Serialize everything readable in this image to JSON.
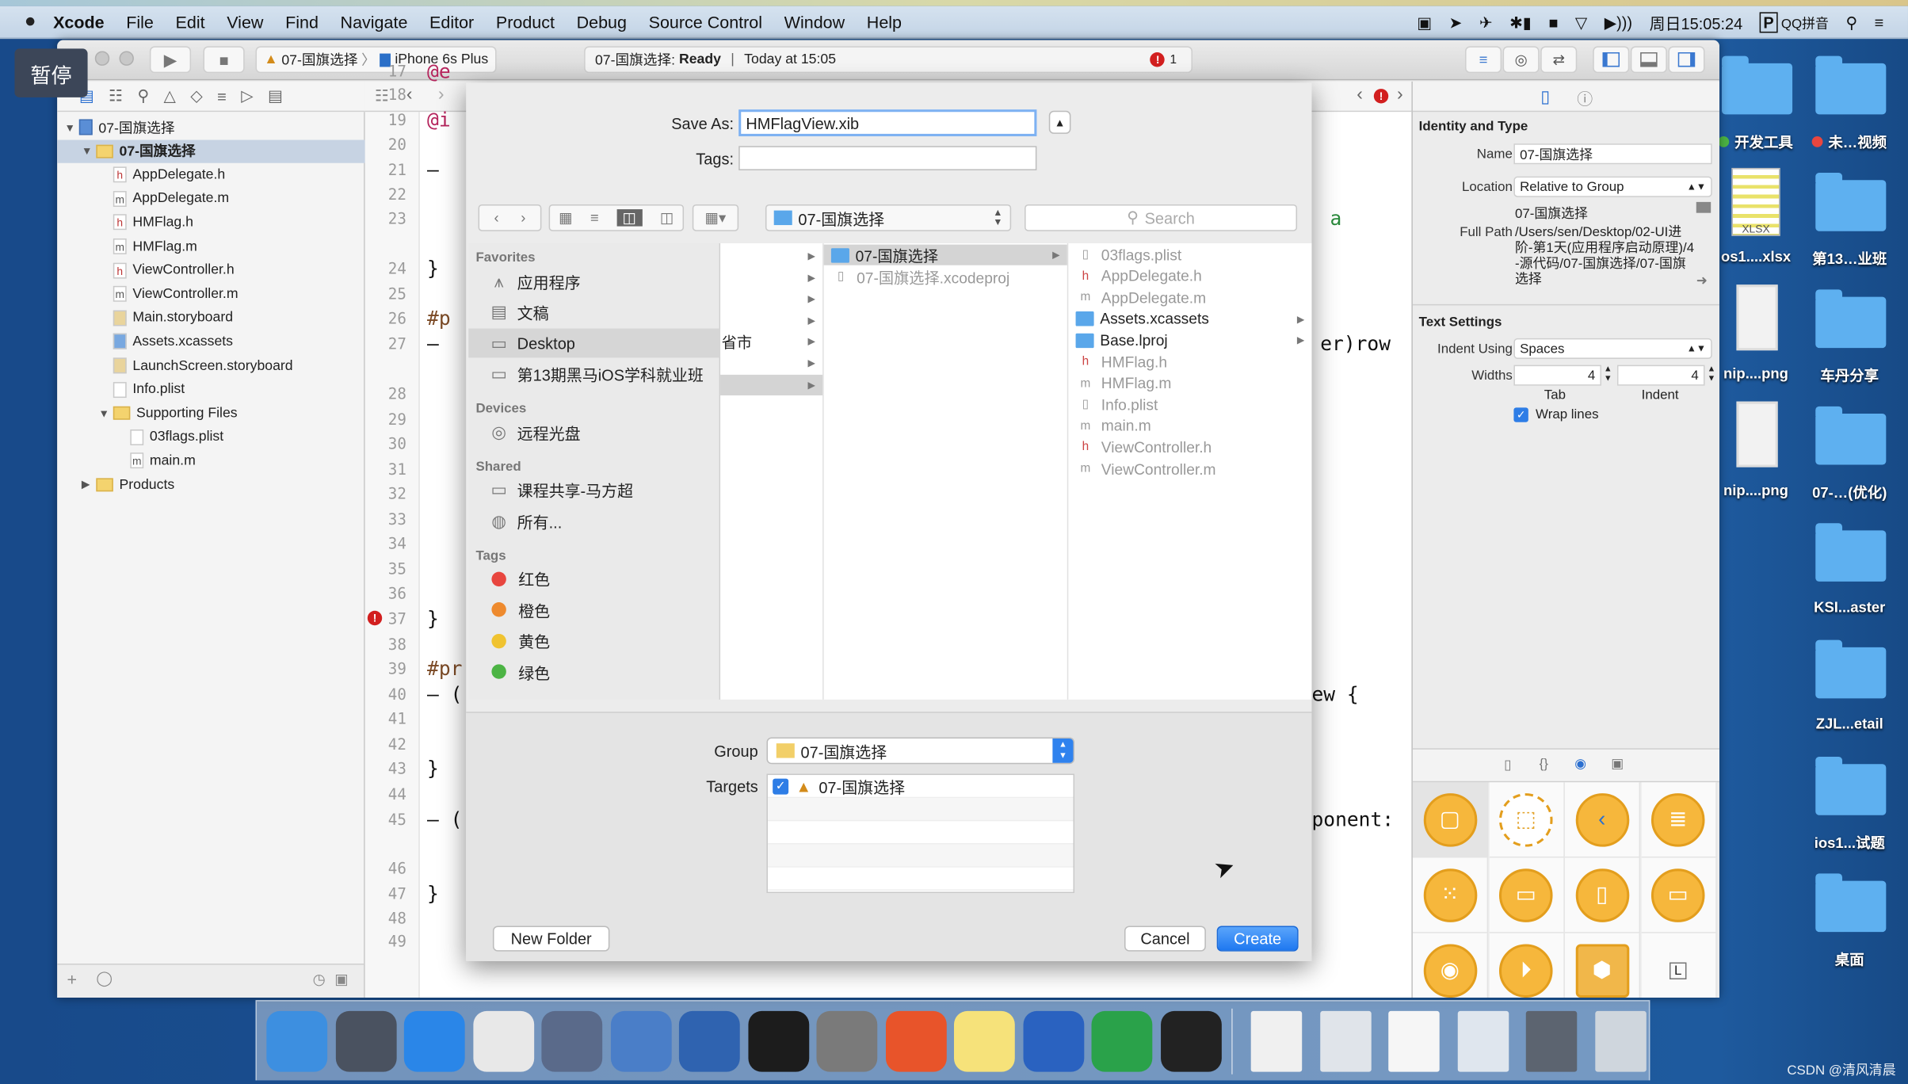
{
  "menubar": {
    "apple_icon": "apple-icon",
    "items": [
      "Xcode",
      "File",
      "Edit",
      "View",
      "Find",
      "Navigate",
      "Editor",
      "Product",
      "Debug",
      "Source Control",
      "Window",
      "Help"
    ],
    "status_icons": [
      "screen-record-icon",
      "location-arrow-icon",
      "airplane-icon",
      "bluetooth-battery-icon",
      "lock-icon",
      "wifi-icon",
      "volume-icon"
    ],
    "clock": "周日15:05:24",
    "input_method": "QQ拼音",
    "input_method_badge": "P"
  },
  "overlay": {
    "pause_label": "暂停"
  },
  "toolbar": {
    "scheme": "07-国旗选择",
    "device": "iPhone 6s Plus",
    "activity_project": "07-国旗选择:",
    "activity_status": "Ready",
    "activity_time": "Today at 15:05",
    "error_count": "1"
  },
  "navigator": {
    "items": [
      {
        "label": "07-国旗选择",
        "type": "proj",
        "depth": 0,
        "disclosure": "open"
      },
      {
        "label": "07-国旗选择",
        "type": "folder",
        "depth": 1,
        "disclosure": "open",
        "selected": true,
        "bold": true
      },
      {
        "label": "AppDelegate.h",
        "type": "h",
        "depth": 2
      },
      {
        "label": "AppDelegate.m",
        "type": "m",
        "depth": 2
      },
      {
        "label": "HMFlag.h",
        "type": "h",
        "depth": 2
      },
      {
        "label": "HMFlag.m",
        "type": "m",
        "depth": 2
      },
      {
        "label": "ViewController.h",
        "type": "h",
        "depth": 2
      },
      {
        "label": "ViewController.m",
        "type": "m",
        "depth": 2
      },
      {
        "label": "Main.storyboard",
        "type": "sb",
        "depth": 2
      },
      {
        "label": "Assets.xcassets",
        "type": "as",
        "depth": 2
      },
      {
        "label": "LaunchScreen.storyboard",
        "type": "sb",
        "depth": 2
      },
      {
        "label": "Info.plist",
        "type": "plist",
        "depth": 2
      },
      {
        "label": "Supporting Files",
        "type": "folder",
        "depth": 2,
        "disclosure": "open"
      },
      {
        "label": "03flags.plist",
        "type": "plist",
        "depth": 3
      },
      {
        "label": "main.m",
        "type": "m",
        "depth": 3
      },
      {
        "label": "Products",
        "type": "folder",
        "depth": 1,
        "disclosure": "closed"
      }
    ]
  },
  "editor": {
    "line_numbers": [
      "17",
      "18",
      "19",
      "20",
      "21",
      "22",
      "23",
      "24",
      "25",
      "26",
      "27",
      "28",
      "29",
      "30",
      "31",
      "32",
      "33",
      "34",
      "35",
      "36",
      "37",
      "38",
      "39",
      "40",
      "41",
      "42",
      "43",
      "44",
      "45",
      "46",
      "47",
      "48",
      "49"
    ],
    "error_line": "37",
    "fragments_left": [
      {
        "line": "17",
        "text": "@e",
        "cls": "kw"
      },
      {
        "line": "19",
        "text": "@i",
        "cls": "kw"
      },
      {
        "line": "21",
        "text": "–",
        "cls": ""
      },
      {
        "line": "24",
        "text": "}",
        "cls": ""
      },
      {
        "line": "26",
        "text": "#p",
        "cls": "pp"
      },
      {
        "line": "27",
        "text": "–",
        "cls": ""
      },
      {
        "line": "37",
        "text": "}",
        "cls": ""
      },
      {
        "line": "39",
        "text": "#pr",
        "cls": "pp"
      },
      {
        "line": "40",
        "text": "– (",
        "cls": ""
      },
      {
        "line": "43",
        "text": "}",
        "cls": ""
      },
      {
        "line": "45",
        "text": "– (",
        "cls": ""
      },
      {
        "line": "47",
        "text": "}",
        "cls": ""
      }
    ],
    "fragments_right": [
      {
        "line": "23",
        "text": "a",
        "cls": "gr"
      },
      {
        "line": "27",
        "text": "er)row",
        "cls": "mixed"
      },
      {
        "line": "40",
        "text": "ew {",
        "cls": ""
      },
      {
        "line": "45",
        "text": "ponent:",
        "cls": ""
      }
    ]
  },
  "inspector": {
    "identity_title": "Identity and Type",
    "name_label": "Name",
    "name_value": "07-国旗选择",
    "location_label": "Location",
    "location_value": "Relative to Group",
    "location_path": "07-国旗选择",
    "full_path_label": "Full Path",
    "full_path_value": "/Users/sen/Desktop/02-UI进阶-第1天(应用程序启动原理)/4-源代码/07-国旗选择/07-国旗选择",
    "text_settings_title": "Text Settings",
    "indent_using_label": "Indent Using",
    "indent_using_value": "Spaces",
    "widths_label": "Widths",
    "tab_width": "4",
    "indent_width": "4",
    "tab_label": "Tab",
    "indent_label": "Indent",
    "wrap_lines_label": "Wrap lines",
    "wrap_lines_checked": true,
    "library_icons": [
      "view-controller-icon",
      "storyboard-reference-icon",
      "navigation-controller-icon",
      "table-view-controller-icon",
      "collection-view-controller-icon",
      "tab-bar-controller-icon",
      "split-view-controller-icon",
      "page-view-controller-icon",
      "glkit-view-controller-icon",
      "avkit-player-view-controller-icon",
      "object-icon",
      "label-icon"
    ],
    "label_glyph": "L"
  },
  "dialog": {
    "save_as_label": "Save As:",
    "save_as_value": "HMFlagView.xib",
    "tags_label": "Tags:",
    "tags_value": "",
    "location_popup": "07-国旗选择",
    "search_placeholder": "Search",
    "sidebar": {
      "favorites_header": "Favorites",
      "favorites": [
        {
          "label": "应用程序",
          "icon": "applications-icon"
        },
        {
          "label": "文稿",
          "icon": "documents-icon"
        },
        {
          "label": "Desktop",
          "icon": "desktop-icon",
          "selected": true
        },
        {
          "label": "第13期黑马iOS学科就业班",
          "icon": "folder-icon"
        }
      ],
      "devices_header": "Devices",
      "devices": [
        {
          "label": "远程光盘",
          "icon": "remote-disc-icon"
        }
      ],
      "shared_header": "Shared",
      "shared": [
        {
          "label": "课程共享-马方超",
          "icon": "computer-icon"
        },
        {
          "label": "所有...",
          "icon": "network-icon"
        }
      ],
      "tags_header": "Tags",
      "tags": [
        {
          "label": "红色",
          "color": "#e8463f"
        },
        {
          "label": "橙色",
          "color": "#ee8a2e"
        },
        {
          "label": "黄色",
          "color": "#f0c330"
        },
        {
          "label": "绿色",
          "color": "#4cb444"
        }
      ]
    },
    "column1": [
      {
        "label": ""
      },
      {
        "label": ""
      },
      {
        "label": ""
      },
      {
        "label": ""
      },
      {
        "label": "省市"
      },
      {
        "label": ""
      },
      {
        "label": "",
        "selected": true
      }
    ],
    "column2": [
      {
        "label": "07-国旗选择",
        "type": "folder",
        "selected": true,
        "arrow": true
      },
      {
        "label": "07-国旗选择.xcodeproj",
        "type": "proj"
      }
    ],
    "column3": [
      {
        "label": "03flags.plist",
        "type": "plist"
      },
      {
        "label": "AppDelegate.h",
        "type": "h"
      },
      {
        "label": "AppDelegate.m",
        "type": "m"
      },
      {
        "label": "Assets.xcassets",
        "type": "folder",
        "arrow": true
      },
      {
        "label": "Base.lproj",
        "type": "folder",
        "arrow": true
      },
      {
        "label": "HMFlag.h",
        "type": "h"
      },
      {
        "label": "HMFlag.m",
        "type": "m"
      },
      {
        "label": "Info.plist",
        "type": "plist"
      },
      {
        "label": "main.m",
        "type": "m"
      },
      {
        "label": "ViewController.h",
        "type": "h"
      },
      {
        "label": "ViewController.m",
        "type": "m"
      }
    ],
    "group_label": "Group",
    "group_value": "07-国旗选择",
    "targets_label": "Targets",
    "targets": [
      {
        "label": "07-国旗选择",
        "checked": true
      }
    ],
    "new_folder_label": "New Folder",
    "cancel_label": "Cancel",
    "create_label": "Create"
  },
  "desktop": {
    "items": [
      {
        "label": "开发工具",
        "kind": "folder",
        "tag": "#4cb444"
      },
      {
        "label": "未…视频",
        "kind": "folder",
        "tag": "#e8463f"
      },
      {
        "label": "os1....xlsx",
        "kind": "xlsx",
        "badge": "XLSX"
      },
      {
        "label": "第13…业班",
        "kind": "folder"
      },
      {
        "label": "nip....png",
        "kind": "image"
      },
      {
        "label": "车丹分享",
        "kind": "folder"
      },
      {
        "label": "nip....png",
        "kind": "image"
      },
      {
        "label": "07-…(优化)",
        "kind": "folder"
      },
      {
        "label": "KSI...aster",
        "kind": "folder"
      },
      {
        "label": "ZJL...etail",
        "kind": "folder"
      },
      {
        "label": "ios1...试题",
        "kind": "folder"
      },
      {
        "label": "桌面",
        "kind": "folder"
      }
    ]
  },
  "dock": {
    "apps": [
      {
        "name": "finder-icon",
        "color": "#3d8fe0"
      },
      {
        "name": "launchpad-icon",
        "color": "#4a5260"
      },
      {
        "name": "safari-icon",
        "color": "#2a86e8"
      },
      {
        "name": "mouse-app-icon",
        "color": "#e8e8e8"
      },
      {
        "name": "imovie-icon",
        "color": "#5a6a8a"
      },
      {
        "name": "xcode-icon",
        "color": "#4a7ec8"
      },
      {
        "name": "instruments-icon",
        "color": "#2f63b0"
      },
      {
        "name": "terminal-icon",
        "color": "#1c1c1c"
      },
      {
        "name": "system-preferences-icon",
        "color": "#7a7a7a"
      },
      {
        "name": "wps-presentation-icon",
        "color": "#e8542a"
      },
      {
        "name": "notes-icon",
        "color": "#f6e27a"
      },
      {
        "name": "word-icon",
        "color": "#2a62c0"
      },
      {
        "name": "excel-icon",
        "color": "#2aa24a"
      },
      {
        "name": "console-icon",
        "color": "#222"
      },
      {
        "name": "document-stack-icon",
        "color": "#f0f0f0"
      },
      {
        "name": "screenshot-stack-icon",
        "color": "#e0e4ea"
      },
      {
        "name": "text-document-icon",
        "color": "#f6f6f6"
      },
      {
        "name": "downloads-stack-icon",
        "color": "#dfe6ee"
      },
      {
        "name": "screen-sharing-icon",
        "color": "#5c6470"
      },
      {
        "name": "trash-icon",
        "color": "#cfd6dd"
      }
    ]
  },
  "watermark": "CSDN @清风清晨",
  "colors": {
    "accent": "#1f78f0",
    "error": "#d21f1f",
    "desktop": "#1b4e8e",
    "folder": "#5aa7ea"
  }
}
